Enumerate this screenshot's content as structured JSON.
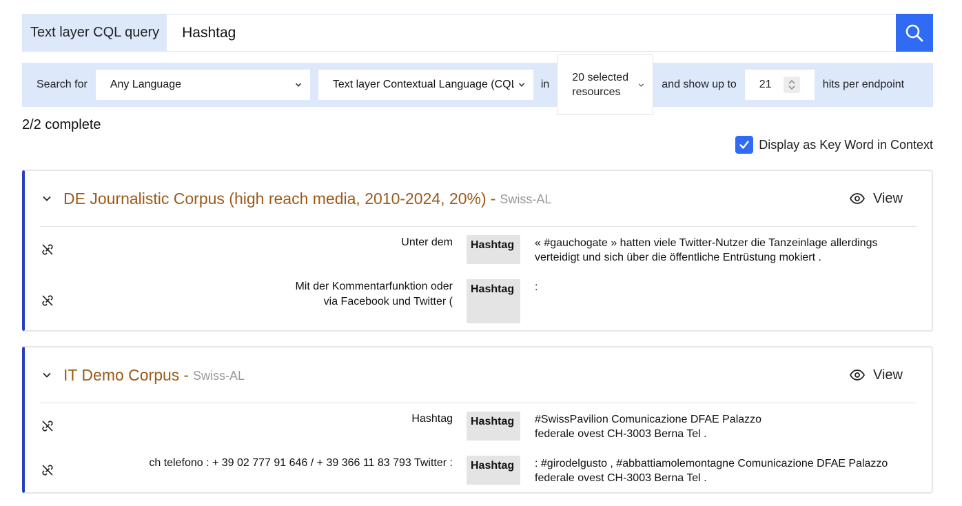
{
  "query": {
    "label": "Text layer CQL query",
    "value": "Hashtag"
  },
  "filters": {
    "search_for_label": "Search for",
    "language_value": "Any Language",
    "layer_value": "Text layer Contextual Language (CQL)",
    "in_label": "in",
    "resources_value": "20 selected resources",
    "show_up_to_label": "and show up to",
    "hits_value": "21",
    "hits_suffix": "hits per endpoint"
  },
  "status": "2/2 complete",
  "kwic_toggle": {
    "label": "Display as Key Word in Context",
    "checked": true
  },
  "results": [
    {
      "title": "DE Journalistic Corpus (high reach media, 2010-2024, 20%)",
      "separator": "-",
      "source": "Swiss-AL",
      "view_label": "View",
      "rows": [
        {
          "left": "Unter dem",
          "hit": "Hashtag",
          "right": "« #gauchogate » hatten viele Twitter-Nutzer die Tanzeinlage allerdings verteidigt und sich über die öffentliche Entrüstung mokiert ."
        },
        {
          "left": "Mit der Kommentarfunktion oder via Facebook und Twitter (",
          "hit": "Hashtag",
          "right": ":"
        }
      ]
    },
    {
      "title": "IT Demo Corpus",
      "separator": "-",
      "source": "Swiss-AL",
      "view_label": "View",
      "rows": [
        {
          "left": "Hashtag",
          "hit": "Hashtag",
          "right": "#SwissPavilion Comunicazione DFAE Palazzo federale ovest CH-3003 Berna Tel ."
        },
        {
          "left": "ch telefono : + 39 02 777 91 646 / + 39 366 11 83 793 Twitter :",
          "hit": "Hashtag",
          "right": ": #girodelgusto , #abbattiamolemontagne Comunicazione DFAE Palazzo federale ovest CH-3003 Berna Tel ."
        }
      ]
    }
  ],
  "colors": {
    "accent": "#2f6bf5",
    "panel": "#dde8fa",
    "title": "#9a5a18",
    "card_border": "#2a3fbf"
  }
}
